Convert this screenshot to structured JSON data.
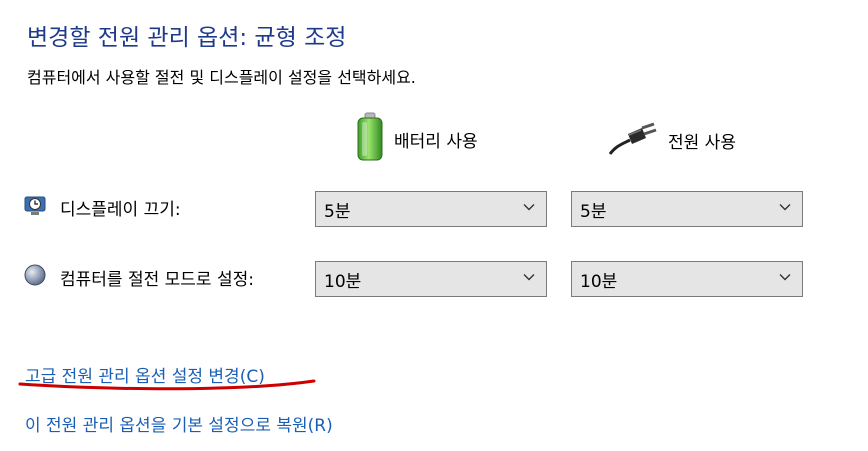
{
  "header": {
    "title": "변경할 전원 관리 옵션: 균형 조정",
    "subtitle": "컴퓨터에서 사용할 절전 및 디스플레이 설정을 선택하세요."
  },
  "columns": {
    "battery": {
      "label": "배터리 사용",
      "icon": "battery-icon"
    },
    "plugged": {
      "label": "전원 사용",
      "icon": "power-plug-icon"
    }
  },
  "rows": {
    "display_off": {
      "label": "디스플레이 끄기:",
      "icon": "monitor-clock-icon",
      "battery_value": "5분",
      "plugged_value": "5분"
    },
    "sleep": {
      "label": "컴퓨터를 절전 모드로 설정:",
      "icon": "moon-icon",
      "battery_value": "10분",
      "plugged_value": "10분"
    }
  },
  "links": {
    "advanced": "고급 전원 관리 옵션 설정 변경(C)",
    "restore": "이 전원 관리 옵션을 기본 설정으로 복원(R)"
  },
  "colors": {
    "title": "#1e3a8a",
    "link": "#1b5fb5",
    "annotation": "#cc0000",
    "dropdown_bg": "#e5e5e5"
  }
}
